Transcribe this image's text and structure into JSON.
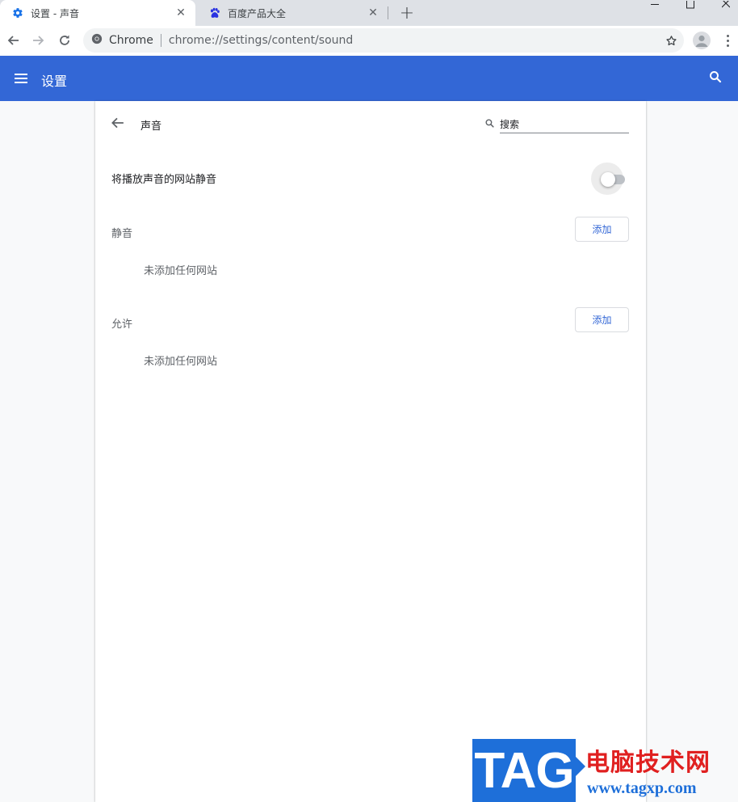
{
  "browser": {
    "tabs": [
      {
        "title": "设置 - 声音",
        "icon": "gear-icon",
        "active": true
      },
      {
        "title": "百度产品大全",
        "icon": "baidu-paw-icon",
        "active": false
      }
    ],
    "omnibox": {
      "site_label": "Chrome",
      "url": "chrome://settings/content/sound"
    }
  },
  "settings": {
    "header_title": "设置"
  },
  "page": {
    "title": "声音",
    "search_placeholder": "搜索",
    "mute_toggle_label": "将播放声音的网站静音",
    "mute_toggle_on": false,
    "sections": [
      {
        "label": "静音",
        "add_label": "添加",
        "empty_text": "未添加任何网站"
      },
      {
        "label": "允许",
        "add_label": "添加",
        "empty_text": "未添加任何网站"
      }
    ]
  },
  "watermark": {
    "badge": "TAG",
    "title": "电脑技术网",
    "url": "www.tagxp.com"
  },
  "colors": {
    "header_blue": "#3367d6",
    "link_blue": "#3367d6",
    "watermark_red": "#e02020",
    "watermark_blue": "#1e6fd9"
  }
}
